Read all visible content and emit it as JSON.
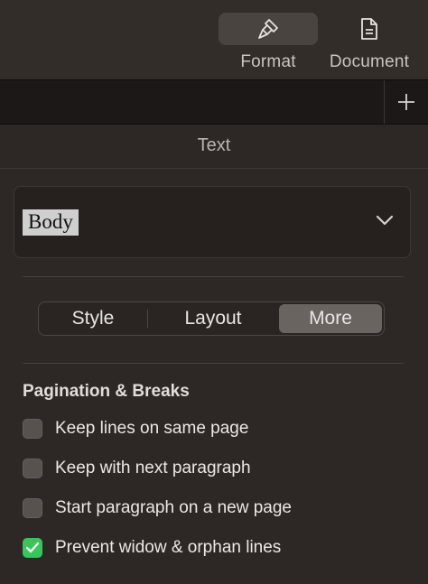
{
  "toolbar": {
    "format_label": "Format",
    "document_label": "Document",
    "format_icon": "paintbrush-icon",
    "document_icon": "document-icon"
  },
  "tabstrip": {
    "add_icon": "plus-icon"
  },
  "panel": {
    "title": "Text"
  },
  "paragraph_style": {
    "name": "Body",
    "chevron_icon": "chevron-down-icon"
  },
  "segmented": {
    "style_label": "Style",
    "layout_label": "Layout",
    "more_label": "More",
    "selected": "More"
  },
  "pagination": {
    "title": "Pagination & Breaks",
    "options": [
      {
        "label": "Keep lines on same page",
        "checked": false
      },
      {
        "label": "Keep with next paragraph",
        "checked": false
      },
      {
        "label": "Start paragraph on a new page",
        "checked": false
      },
      {
        "label": "Prevent widow & orphan lines",
        "checked": true
      }
    ]
  },
  "colors": {
    "accent_check": "#34c759",
    "selected_segment": "#6a6461"
  }
}
